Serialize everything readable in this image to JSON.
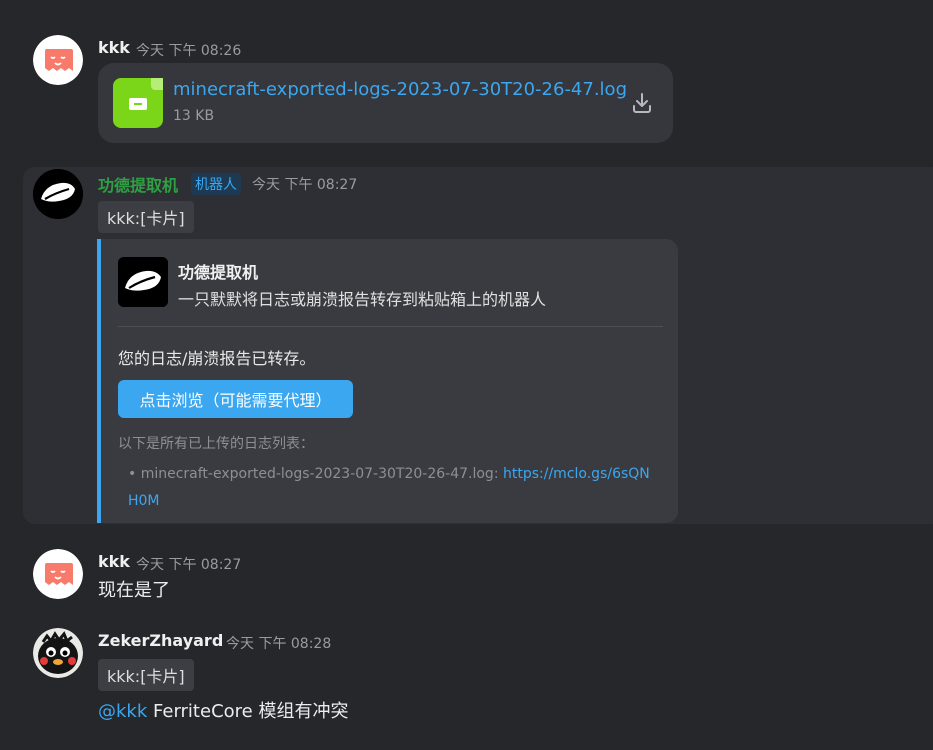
{
  "messages": [
    {
      "author": "kkk",
      "time": "今天 下午 08:26",
      "file": {
        "name": "minecraft-exported-logs-2023-07-30T20-26-47.log",
        "size": "13 KB"
      }
    },
    {
      "author": "功德提取机",
      "author_color": "#2ea043",
      "badge": "机器人",
      "time": "今天 下午 08:27",
      "card_chip": "kkk:[卡片]",
      "embed": {
        "title": "功德提取机",
        "description": "一只默默将日志或崩溃报告转存到粘贴箱上的机器人",
        "body": "您的日志/崩溃报告已转存。",
        "button": "点击浏览（可能需要代理）",
        "list_heading": "以下是所有已上传的日志列表：",
        "list_item_file": "• minecraft-exported-logs-2023-07-30T20-26-47.log: ",
        "list_item_link": "https://mclo.gs/6sQNH0M"
      }
    },
    {
      "author": "kkk",
      "time": "今天 下午 08:27",
      "text": "现在是了"
    },
    {
      "author": "ZekerZhayard",
      "time": "今天 下午 08:28",
      "card_chip": "kkk:[卡片]",
      "mention": "@kkk",
      "text": " FerriteCore 模组有冲突"
    }
  ],
  "colors": {
    "background": "#26272b",
    "accent": "#3aa7f0",
    "bot_name": "#2ea043",
    "file_icon": "#7bd619",
    "avatar_kkk": "#f77a6a"
  },
  "icons": [
    "file-icon",
    "download-icon",
    "avatar-kkk",
    "avatar-bot",
    "avatar-zeker"
  ]
}
